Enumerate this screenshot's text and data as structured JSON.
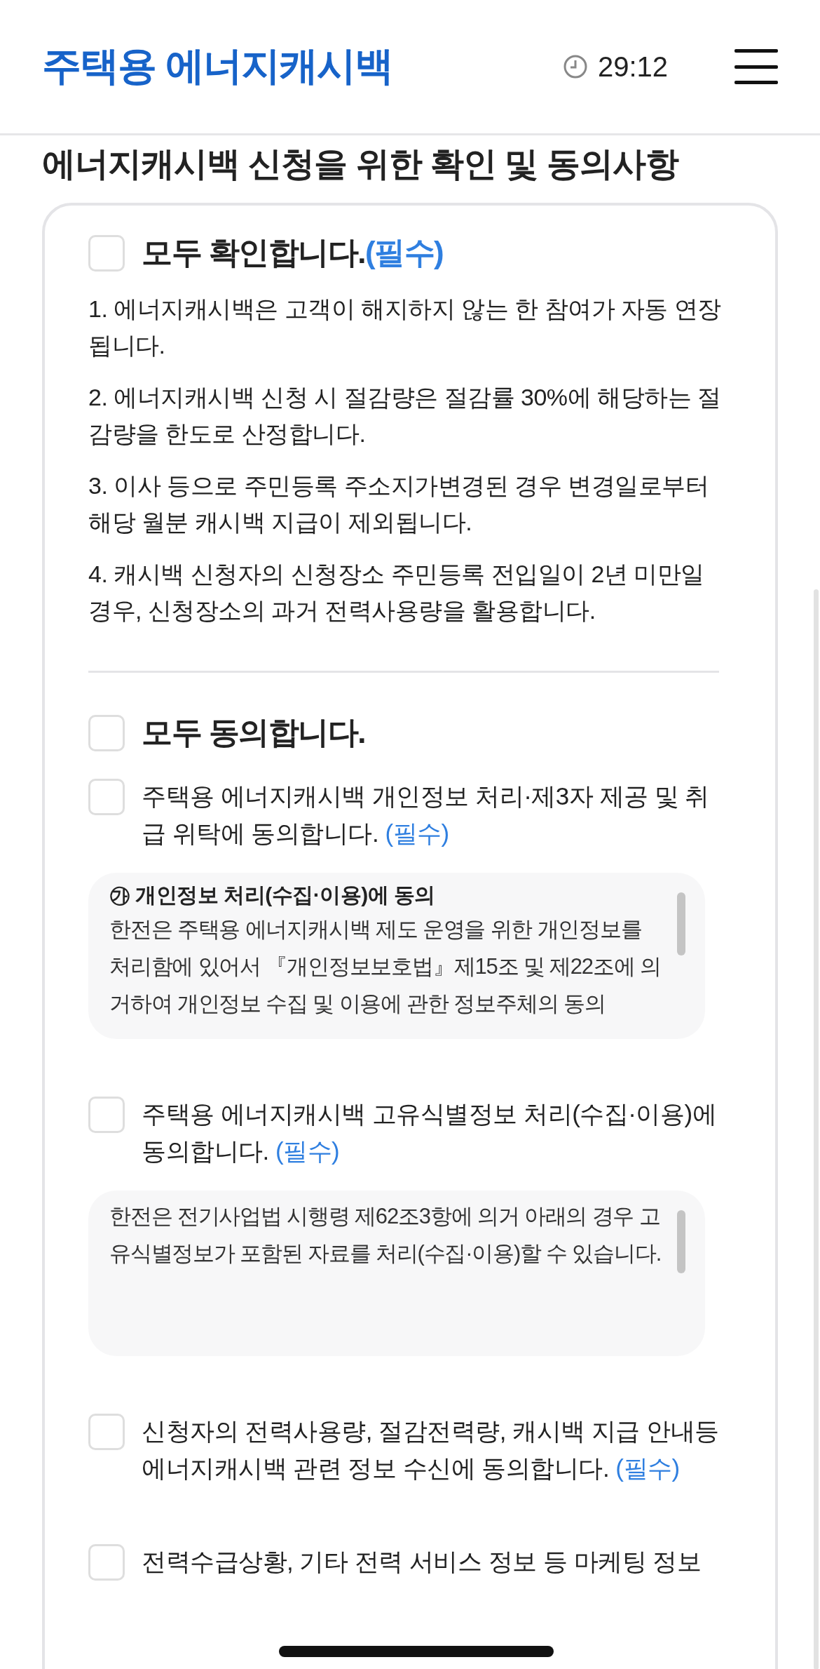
{
  "header": {
    "logo": "주택용 에너지캐시백",
    "timer": "29:12"
  },
  "title": "에너지캐시백 신청을 위한 확인 및 동의사항",
  "confirm_all": {
    "label": "모두 확인합니다.",
    "required": "(필수)",
    "checked": false
  },
  "notices": [
    "1. 에너지캐시백은 고객이 해지하지 않는 한 참여가 자동 연장됩니다.",
    "2. 에너지캐시백 신청 시 절감량은 절감률 30%에 해당하는 절감량을 한도로 산정합니다.",
    "3. 이사 등으로 주민등록 주소지가변경된 경우 변경일로부터 해당 월분 캐시백 지급이 제외됩니다.",
    "4. 캐시백 신청자의 신청장소 주민등록 전입일이 2년 미만일 경우, 신청장소의 과거 전력사용량을 활용합니다."
  ],
  "agree_all": {
    "label": "모두 동의합니다.",
    "checked": false
  },
  "agreements": [
    {
      "label": "주택용 에너지캐시백 개인정보 처리·제3자 제공 및 취급 위탁에 동의합니다.",
      "required": "(필수)",
      "checked": false,
      "detail": {
        "heading": "㉮ 개인정보 처리(수집·이용)에 동의",
        "paragraphs": [
          "한전은 주택용 에너지캐시백 제도 운영을 위한 개인정보를 처리함에 있어서 『개인정보보호법』제15조 및 제22조에 의거하여 개인정보 수집 및 이용에 관한 정보주체의 동의"
        ]
      }
    },
    {
      "label": "주택용 에너지캐시백 고유식별정보 처리(수집·이용)에 동의합니다.",
      "required": "(필수)",
      "checked": false,
      "detail": {
        "paragraphs": [
          "한전은 전기사업법 시행령 제62조3항에 의거 아래의 경우 고유식별정보가 포함된 자료를 처리(수집·이용)할 수 있습니다."
        ]
      }
    },
    {
      "label": "신청자의 전력사용량, 절감전력량, 캐시백 지급 안내등 에너지캐시백 관련 정보 수신에 동의합니다.",
      "required": "(필수)",
      "checked": false
    },
    {
      "label": "전력수급상황, 기타 전력 서비스 정보 등 마케팅 정보",
      "checked": false
    }
  ]
}
